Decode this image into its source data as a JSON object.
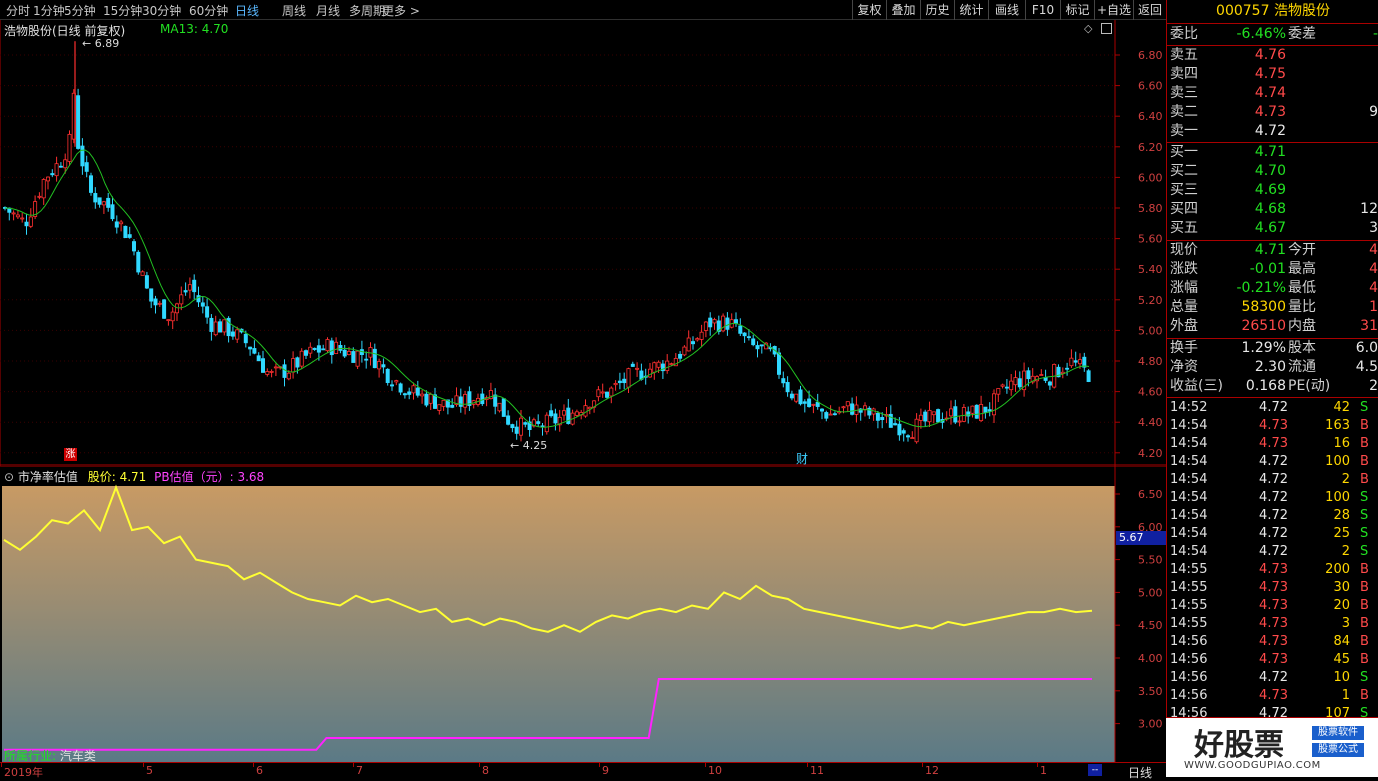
{
  "toolbar": {
    "items": [
      "分时",
      "1分钟",
      "5分钟",
      "15分钟",
      "30分钟",
      "60分钟",
      "日线",
      "周线",
      "月线",
      "多周期",
      "更多 >"
    ],
    "active": "日线",
    "right_items": [
      "复权",
      "叠加",
      "历史",
      "统计",
      "画线",
      "F10",
      "标记",
      "+自选",
      "返回"
    ]
  },
  "main": {
    "title": "浩物股份(日线 前复权)",
    "ma_label": "MA13: 4.70",
    "high_label": "6.89",
    "low_label": "4.25",
    "zhang_mark": "涨",
    "cai_mark": "财",
    "yaxis": [
      "6.80",
      "6.60",
      "6.40",
      "6.20",
      "6.00",
      "5.80",
      "5.60",
      "5.40",
      "5.20",
      "5.00",
      "4.80",
      "4.60",
      "4.40",
      "4.20"
    ],
    "ma_color": "#22c022",
    "up_color": "#ff3030",
    "down_color": "#30d8ff"
  },
  "pb": {
    "title": "市净率估值",
    "price_label": "股价: 4.71",
    "pb_label": "PB估值（元）: 3.68",
    "industry_label": "所属行业: ",
    "industry_value": "汽车类",
    "yaxis": [
      "6.50",
      "6.00",
      "5.50",
      "5.00",
      "4.50",
      "4.00",
      "3.50",
      "3.00"
    ],
    "current_value": "5.67",
    "price_color": "#ffff33",
    "pb_color": "#ff22ff",
    "price_series": [
      5.8,
      5.65,
      5.85,
      6.1,
      6.05,
      6.25,
      5.95,
      6.6,
      5.95,
      6.0,
      5.75,
      5.85,
      5.5,
      5.45,
      5.4,
      5.2,
      5.3,
      5.15,
      5.0,
      4.9,
      4.85,
      4.8,
      4.95,
      4.85,
      4.9,
      4.8,
      4.7,
      4.75,
      4.55,
      4.6,
      4.5,
      4.6,
      4.55,
      4.45,
      4.4,
      4.5,
      4.4,
      4.55,
      4.65,
      4.6,
      4.7,
      4.75,
      4.7,
      4.8,
      4.75,
      5.0,
      4.9,
      5.1,
      4.95,
      4.9,
      4.75,
      4.7,
      4.65,
      4.6,
      4.55,
      4.5,
      4.45,
      4.5,
      4.45,
      4.55,
      4.5,
      4.55,
      4.6,
      4.65,
      4.7,
      4.7,
      4.75,
      4.7,
      4.72
    ],
    "pb_series": [
      2.6,
      2.6,
      2.6,
      2.6,
      2.6,
      2.6,
      2.6,
      2.6,
      2.6,
      2.6,
      2.6,
      2.6,
      2.6,
      2.6,
      2.6,
      2.6,
      2.6,
      2.6,
      2.6,
      2.6,
      2.6,
      2.6,
      2.6,
      2.6,
      2.6,
      2.6,
      2.6,
      2.6,
      2.6,
      2.6,
      2.6,
      2.6,
      2.78,
      2.78,
      2.78,
      2.78,
      2.78,
      2.78,
      2.78,
      2.78,
      2.78,
      2.78,
      2.78,
      2.78,
      2.78,
      2.78,
      2.78,
      2.78,
      2.78,
      2.78,
      2.78,
      2.78,
      2.78,
      2.78,
      2.78,
      2.78,
      2.78,
      2.78,
      2.78,
      2.78,
      2.78,
      2.78,
      2.78,
      2.78,
      2.78,
      3.68,
      3.68,
      3.68,
      3.68,
      3.68,
      3.68,
      3.68,
      3.68,
      3.68,
      3.68,
      3.68,
      3.68,
      3.68,
      3.68,
      3.68,
      3.68,
      3.68,
      3.68,
      3.68,
      3.68,
      3.68,
      3.68,
      3.68,
      3.68,
      3.68,
      3.68,
      3.68,
      3.68,
      3.68,
      3.68,
      3.68,
      3.68,
      3.68,
      3.68,
      3.68,
      3.68,
      3.68,
      3.68,
      3.68,
      3.68,
      3.68,
      3.68,
      3.68,
      3.68
    ]
  },
  "xaxis": {
    "labels": [
      "2019年",
      "5",
      "6",
      "7",
      "8",
      "9",
      "10",
      "11",
      "12",
      "1"
    ],
    "period": "日线"
  },
  "quote": {
    "code": "000757",
    "name": "浩物股份",
    "weibi_label": "委比",
    "weibi": "-6.46%",
    "weicha_label": "委差",
    "weicha": "-",
    "sell": [
      {
        "label": "卖五",
        "price": "4.76",
        "vol": ""
      },
      {
        "label": "卖四",
        "price": "4.75",
        "vol": ""
      },
      {
        "label": "卖三",
        "price": "4.74",
        "vol": ""
      },
      {
        "label": "卖二",
        "price": "4.73",
        "vol": "9"
      },
      {
        "label": "卖一",
        "price": "4.72",
        "vol": ""
      }
    ],
    "buy": [
      {
        "label": "买一",
        "price": "4.71",
        "vol": ""
      },
      {
        "label": "买二",
        "price": "4.70",
        "vol": ""
      },
      {
        "label": "买三",
        "price": "4.69",
        "vol": ""
      },
      {
        "label": "买四",
        "price": "4.68",
        "vol": "12"
      },
      {
        "label": "买五",
        "price": "4.67",
        "vol": "3"
      }
    ],
    "stats": [
      {
        "l1": "现价",
        "v1": "4.71",
        "c1": "green",
        "l2": "今开",
        "v2": "4"
      },
      {
        "l1": "涨跌",
        "v1": "-0.01",
        "c1": "green",
        "l2": "最高",
        "v2": "4"
      },
      {
        "l1": "涨幅",
        "v1": "-0.21%",
        "c1": "green",
        "l2": "最低",
        "v2": "4"
      },
      {
        "l1": "总量",
        "v1": "58300",
        "c1": "yellow",
        "l2": "量比",
        "v2": "1"
      },
      {
        "l1": "外盘",
        "v1": "26510",
        "c1": "red",
        "l2": "内盘",
        "v2": "31"
      }
    ],
    "stats2": [
      {
        "l1": "换手",
        "v1": "1.29%",
        "l2": "股本",
        "v2": "6.0"
      },
      {
        "l1": "净资",
        "v1": "2.30",
        "l2": "流通",
        "v2": "4.5"
      },
      {
        "l1": "收益(三)",
        "v1": "0.168",
        "l2": "PE(动)",
        "v2": "2"
      }
    ],
    "ticks": [
      {
        "t": "14:52",
        "p": "4.72",
        "pc": "white",
        "v": "42",
        "s": "S"
      },
      {
        "t": "14:54",
        "p": "4.73",
        "pc": "red",
        "v": "163",
        "s": "B"
      },
      {
        "t": "14:54",
        "p": "4.73",
        "pc": "red",
        "v": "16",
        "s": "B"
      },
      {
        "t": "14:54",
        "p": "4.72",
        "pc": "white",
        "v": "100",
        "s": "B"
      },
      {
        "t": "14:54",
        "p": "4.72",
        "pc": "white",
        "v": "2",
        "s": "B"
      },
      {
        "t": "14:54",
        "p": "4.72",
        "pc": "white",
        "v": "100",
        "s": "S"
      },
      {
        "t": "14:54",
        "p": "4.72",
        "pc": "white",
        "v": "28",
        "s": "S"
      },
      {
        "t": "14:54",
        "p": "4.72",
        "pc": "white",
        "v": "25",
        "s": "S"
      },
      {
        "t": "14:54",
        "p": "4.72",
        "pc": "white",
        "v": "2",
        "s": "S"
      },
      {
        "t": "14:55",
        "p": "4.73",
        "pc": "red",
        "v": "200",
        "s": "B"
      },
      {
        "t": "14:55",
        "p": "4.73",
        "pc": "red",
        "v": "30",
        "s": "B"
      },
      {
        "t": "14:55",
        "p": "4.73",
        "pc": "red",
        "v": "20",
        "s": "B"
      },
      {
        "t": "14:55",
        "p": "4.73",
        "pc": "red",
        "v": "3",
        "s": "B"
      },
      {
        "t": "14:56",
        "p": "4.73",
        "pc": "red",
        "v": "84",
        "s": "B"
      },
      {
        "t": "14:56",
        "p": "4.73",
        "pc": "red",
        "v": "45",
        "s": "B"
      },
      {
        "t": "14:56",
        "p": "4.72",
        "pc": "white",
        "v": "10",
        "s": "S"
      },
      {
        "t": "14:56",
        "p": "4.73",
        "pc": "red",
        "v": "1",
        "s": "B"
      },
      {
        "t": "14:56",
        "p": "4.72",
        "pc": "white",
        "v": "107",
        "s": "S"
      }
    ]
  },
  "logo": {
    "text": "好股票",
    "tag1": "股票软件",
    "tag2": "股票公式",
    "url": "WWW.GOODGUPIAO.COM"
  }
}
